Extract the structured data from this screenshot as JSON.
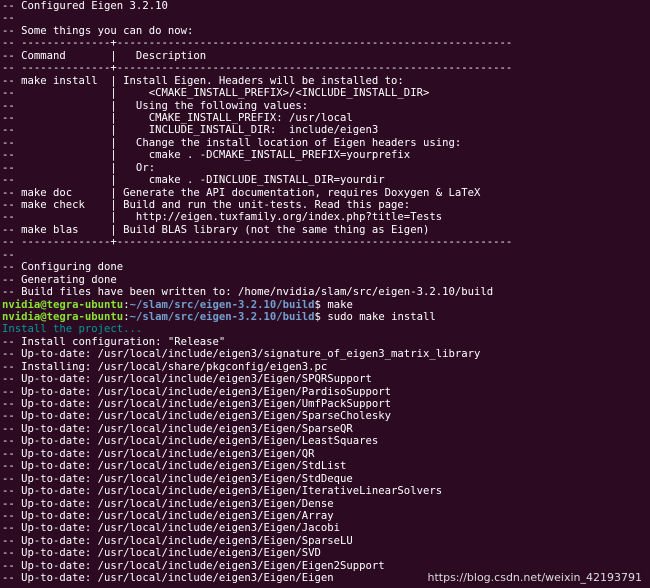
{
  "terminal": {
    "lines": [
      "-- Configured Eigen 3.2.10",
      "--",
      "-- Some things you can do now:",
      "-- --------------+--------------------------------------------------------------",
      "-- Command       |   Description",
      "-- --------------+--------------------------------------------------------------",
      "-- make install  | Install Eigen. Headers will be installed to:",
      "--               |     <CMAKE_INSTALL_PREFIX>/<INCLUDE_INSTALL_DIR>",
      "--               |   Using the following values:",
      "--               |     CMAKE_INSTALL_PREFIX: /usr/local",
      "--               |     INCLUDE_INSTALL_DIR:  include/eigen3",
      "--               |   Change the install location of Eigen headers using:",
      "--               |     cmake . -DCMAKE_INSTALL_PREFIX=yourprefix",
      "--               |   Or:",
      "--               |     cmake . -DINCLUDE_INSTALL_DIR=yourdir",
      "-- make doc      | Generate the API documentation, requires Doxygen & LaTeX",
      "-- make check    | Build and run the unit-tests. Read this page:",
      "--               |   http://eigen.tuxfamily.org/index.php?title=Tests",
      "-- make blas     | Build BLAS library (not the same thing as Eigen)",
      "-- --------------+--------------------------------------------------------------",
      "--",
      "-- Configuring done",
      "-- Generating done",
      "-- Build files have been written to: /home/nvidia/slam/src/eigen-3.2.10/build",
      {
        "type": "prompt",
        "user": "nvidia@tegra-ubuntu",
        "sep": ":",
        "path": "~/slam/src/eigen-3.2.10/build",
        "sym": "$ ",
        "cmd": "make"
      },
      {
        "type": "prompt",
        "user": "nvidia@tegra-ubuntu",
        "sep": ":",
        "path": "~/slam/src/eigen-3.2.10/build",
        "sym": "$ ",
        "cmd": "sudo make install"
      },
      {
        "type": "cyan",
        "text": "Install the project..."
      },
      "-- Install configuration: \"Release\"",
      "-- Up-to-date: /usr/local/include/eigen3/signature_of_eigen3_matrix_library",
      "-- Installing: /usr/local/share/pkgconfig/eigen3.pc",
      "-- Up-to-date: /usr/local/include/eigen3/Eigen/SPQRSupport",
      "-- Up-to-date: /usr/local/include/eigen3/Eigen/PardisoSupport",
      "-- Up-to-date: /usr/local/include/eigen3/Eigen/UmfPackSupport",
      "-- Up-to-date: /usr/local/include/eigen3/Eigen/SparseCholesky",
      "-- Up-to-date: /usr/local/include/eigen3/Eigen/SparseQR",
      "-- Up-to-date: /usr/local/include/eigen3/Eigen/LeastSquares",
      "-- Up-to-date: /usr/local/include/eigen3/Eigen/QR",
      "-- Up-to-date: /usr/local/include/eigen3/Eigen/StdList",
      "-- Up-to-date: /usr/local/include/eigen3/Eigen/StdDeque",
      "-- Up-to-date: /usr/local/include/eigen3/Eigen/IterativeLinearSolvers",
      "-- Up-to-date: /usr/local/include/eigen3/Eigen/Dense",
      "-- Up-to-date: /usr/local/include/eigen3/Eigen/Array",
      "-- Up-to-date: /usr/local/include/eigen3/Eigen/Jacobi",
      "-- Up-to-date: /usr/local/include/eigen3/Eigen/SparseLU",
      "-- Up-to-date: /usr/local/include/eigen3/Eigen/SVD",
      "-- Up-to-date: /usr/local/include/eigen3/Eigen/Eigen2Support",
      "-- Up-to-date: /usr/local/include/eigen3/Eigen/Eigen"
    ]
  },
  "watermark": "https://blog.csdn.net/weixin_42193791",
  "colors": {
    "background": "#2c0a22",
    "text": "#ffffff",
    "prompt_user": "#8ae234",
    "prompt_path": "#729fcf",
    "info": "#06989a"
  }
}
